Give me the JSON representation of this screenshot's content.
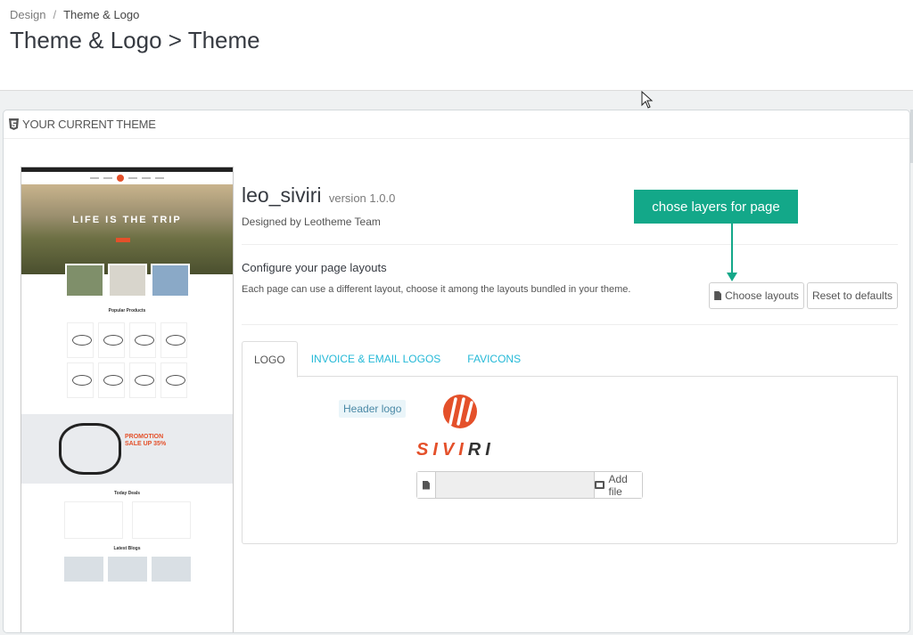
{
  "breadcrumb": {
    "parent": "Design",
    "separator": "/",
    "current": "Theme & Logo"
  },
  "page_title": "Theme & Logo > Theme",
  "panel": {
    "heading": "YOUR CURRENT THEME"
  },
  "preview": {
    "hero_title": "LIFE IS THE TRIP",
    "promo_text": "PROMOTION SALE UP 35%",
    "popular_title": "Popular Products",
    "deals_title": "Today Deals",
    "blogs_title": "Latest Blogs"
  },
  "theme": {
    "name": "leo_siviri",
    "version": "version 1.0.0",
    "author": "Designed by Leotheme Team"
  },
  "layouts": {
    "title": "Configure your page layouts",
    "description": "Each page can use a different layout, choose it among the layouts bundled in your theme.",
    "choose_label": "Choose layouts",
    "reset_label": "Reset to defaults"
  },
  "annotation": {
    "text": "chose layers for page",
    "color": "#13a889"
  },
  "tabs": [
    {
      "label": "LOGO",
      "active": true
    },
    {
      "label": "INVOICE & EMAIL LOGOS",
      "active": false
    },
    {
      "label": "FAVICONS",
      "active": false
    }
  ],
  "logo_tab": {
    "label": "Header logo",
    "logo_text_accent": "SIVI",
    "logo_text_dark": "RI",
    "add_file_label": "Add file",
    "file_value": ""
  },
  "colors": {
    "link": "#25b9d7",
    "brand": "#e4502a",
    "title": "#363a41"
  }
}
